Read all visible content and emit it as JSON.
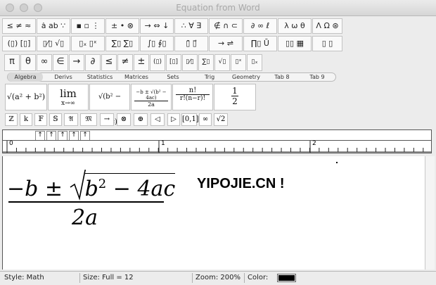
{
  "window": {
    "title": "Equation from Word"
  },
  "palette_row1": [
    "≤ ≠ ≈",
    "ȧ ab ∵",
    "▪ ▫ ⋮",
    "± • ⊗",
    "→ ⇔ ↓",
    "∴ ∀ ∃",
    "∉ ∩ ⊂",
    "∂ ∞ ℓ",
    "λ ω θ",
    "Λ Ω ⊛"
  ],
  "palette_row2": [
    "(▯) [▯]",
    "▯⁄▯ √▯",
    "▯ₓ ▯ˣ",
    "∑▯ ∑▯",
    "∫▯ ∮▯",
    "▯̄ ▯⃗",
    "→ ⇌",
    "∏▯ Ū",
    "▯▯ ▦",
    "▯ ▯"
  ],
  "palette_row3": [
    "π",
    "θ",
    "∞",
    "∈",
    "→",
    "∂",
    "≤",
    "≠",
    "±",
    "(▯)",
    "[▯]",
    "▯⁄▯",
    "∑▯",
    "√▯",
    "▯ˣ",
    "▯ₓ"
  ],
  "tabs": [
    "Algebra",
    "Derivs",
    "Statistics",
    "Matrices",
    "Sets",
    "Trig",
    "Geometry",
    "Tab 8",
    "Tab 9"
  ],
  "templates": {
    "t1": "√(a² + b²)",
    "t2_top": "lim",
    "t2_bot": "x→∞",
    "t3": "√(b² − 4ac)",
    "t4_num": "−b ± √(b² − 4ac)",
    "t4_den": "2a",
    "t5_num": "n!",
    "t5_den": "r!(n−r)!",
    "t6_num": "1",
    "t6_den": "2"
  },
  "small_symbols": [
    "ℤ",
    "k",
    "𝔽",
    "𝕊",
    "𝔄",
    "𝔐",
    "→",
    "⊗",
    "⊕",
    "◁",
    "▷",
    "[0,1]",
    "∞",
    "√2"
  ],
  "ruler": {
    "labels": [
      "0",
      "1",
      "2"
    ],
    "tab_buttons": [
      "↑",
      "↑",
      "↑",
      "↑",
      "↑"
    ]
  },
  "equation": {
    "minus_b": "−b",
    "pm": "±",
    "b": "b",
    "exp2": "2",
    "minus4ac": "− 4ac",
    "denominator": "2a"
  },
  "watermark": "YIPOJIE.CN !",
  "status": {
    "style": "Style: Math",
    "size": "Size: Full = 12",
    "zoom": "Zoom: 200%",
    "color": "Color:",
    "color_swatch": "#000000"
  }
}
